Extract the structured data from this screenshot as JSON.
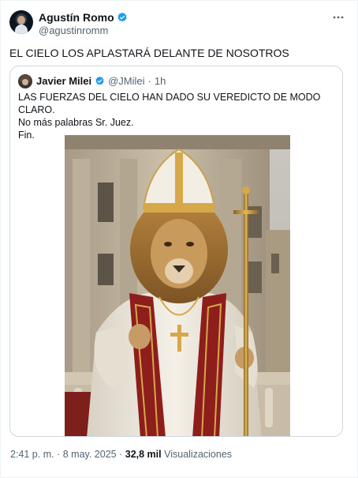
{
  "tweet": {
    "author_name": "Agustín Romo",
    "author_handle": "@agustinromm",
    "text": "EL CIELO LOS APLASTARÁ DELANTE DE NOSOTROS",
    "more_icon": "more-horizontal-icon"
  },
  "quoted_tweet": {
    "author_name": "Javier Milei",
    "author_handle": "@JMilei",
    "separator": "·",
    "time": "1h",
    "lines": [
      "LAS FUERZAS DEL CIELO HAN DADO SU VEREDICTO DE MODO CLARO.",
      "No más palabras Sr. Juez.",
      "Fin."
    ]
  },
  "footer": {
    "time": "2:41 p. m.",
    "sep1": "·",
    "date": "8 may. 2025",
    "sep2": "·",
    "views_count": "32,8 mil",
    "views_label": "Visualizaciones"
  },
  "colors": {
    "verified": "#1d9bf0",
    "text": "#0f1419",
    "secondary": "#536471",
    "border": "#cfd9de"
  }
}
